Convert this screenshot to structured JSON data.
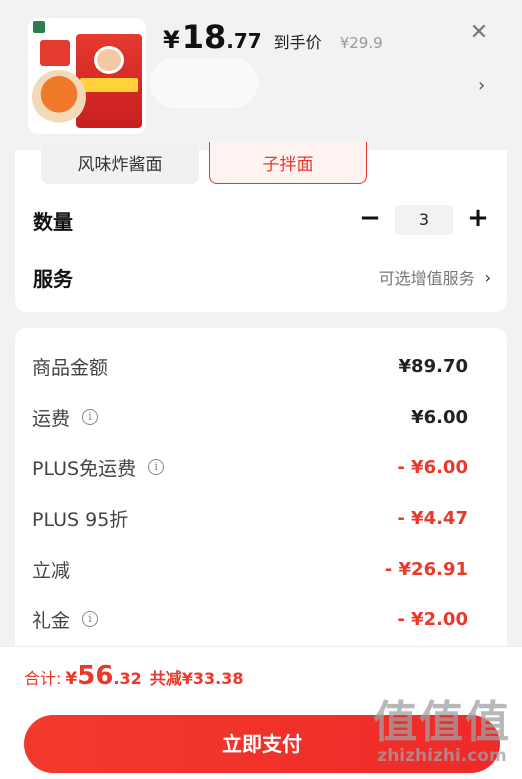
{
  "header": {
    "price_symbol": "¥",
    "price_integer": "18",
    "price_decimal": ".77",
    "price_tag": "到手价",
    "original_price": "¥29.9",
    "close_icon": "✕",
    "chevron_icon": "›"
  },
  "specs": [
    {
      "label": "风味炸酱面",
      "selected": false
    },
    {
      "label": "子拌面",
      "selected": true
    }
  ],
  "quantity": {
    "label": "数量",
    "minus": "−",
    "value": "3",
    "plus": "+"
  },
  "service": {
    "label": "服务",
    "value": "可选增值服务",
    "chevron": "›"
  },
  "summary": {
    "rows": [
      {
        "label": "商品金额",
        "value": "¥89.70",
        "red": false,
        "info": false
      },
      {
        "label": "运费",
        "value": "¥6.00",
        "red": false,
        "info": true
      },
      {
        "label": "PLUS免运费",
        "value": "- ¥6.00",
        "red": true,
        "info": true
      },
      {
        "label": "PLUS 95折",
        "value": "- ¥4.47",
        "red": true,
        "info": false
      },
      {
        "label": "立减",
        "value": "- ¥26.91",
        "red": true,
        "info": false
      },
      {
        "label": "礼金",
        "value": "- ¥2.00",
        "red": true,
        "info": true
      }
    ]
  },
  "footer": {
    "total_label": "合计:",
    "total_symbol": "¥",
    "total_integer": "56",
    "total_decimal": ".32",
    "total_saved": "共减¥33.38",
    "pay_label": "立即支付"
  },
  "watermark": {
    "big": "值值值",
    "small": "zhizhizhi.com"
  },
  "colors": {
    "accent": "#e8392b",
    "background": "#f2f2f2"
  }
}
